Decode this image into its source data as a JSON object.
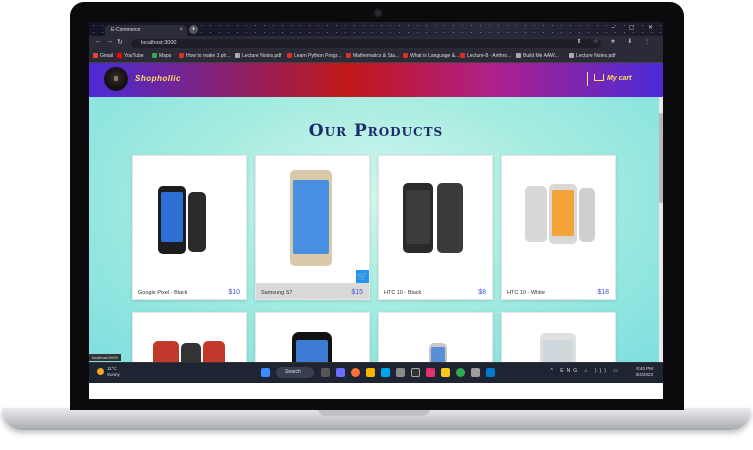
{
  "browser": {
    "tab_title": "E-Commerce",
    "tab_close": "×",
    "new_tab": "+",
    "window_buttons": "– ▢ ✕",
    "back": "←",
    "forward": "→",
    "reload": "↻",
    "url": "localhost:3000",
    "address_icons": "⬆ ☆ ★ ⬇ ⋮",
    "bookmarks": [
      {
        "label": "Gmail",
        "color": "#ea4335"
      },
      {
        "label": "YouTube",
        "color": "#ff0000"
      },
      {
        "label": "Maps",
        "color": "#34a853"
      },
      {
        "label": "How to make 3 ph...",
        "color": "#d93025"
      },
      {
        "label": "Lecture Notes.pdf",
        "color": "#aaaaaa"
      },
      {
        "label": "Learn Python Progr...",
        "color": "#d93025"
      },
      {
        "label": "Mathematics & Sta...",
        "color": "#d93025"
      },
      {
        "label": "What is Language &...",
        "color": "#d93025"
      },
      {
        "label": "Lecture-8 - Anthro...",
        "color": "#d93025"
      },
      {
        "label": "Build Me AAW...",
        "color": "#aaaaaa"
      },
      {
        "label": "Lecture Notes.pdf",
        "color": "#aaaaaa"
      }
    ]
  },
  "navbar": {
    "brand": "Shophollic",
    "cart_label": "My cart"
  },
  "main": {
    "heading": "Our Products",
    "products": [
      {
        "name": "Google Pixel - Black",
        "price": "$10",
        "phone_color": "#1d1d1f",
        "screen_color": "#2e6fd6"
      },
      {
        "name": "Samsung S7",
        "price": "$15",
        "phone_color": "#d9c9a8",
        "screen_color": "#4a90e2"
      },
      {
        "name": "HTC 10 - Black",
        "price": "$8",
        "phone_color": "#2a2a2a",
        "screen_color": "#3b3b3b"
      },
      {
        "name": "HTC 10 - White",
        "price": "$18",
        "phone_color": "#d8d8d8",
        "screen_color": "#f2a33a"
      },
      {
        "name": "",
        "price": "",
        "phone_color": "#c0392b",
        "screen_color": "#333333"
      },
      {
        "name": "",
        "price": "",
        "phone_color": "#111111",
        "screen_color": "#3c7bd6"
      },
      {
        "name": "",
        "price": "",
        "phone_color": "#c7c7c7",
        "screen_color": "#5a8fd6"
      },
      {
        "name": "",
        "price": "",
        "phone_color": "#e0e0e0",
        "screen_color": "#cfd8dc"
      }
    ],
    "add_to_cart_icon": "🛒"
  },
  "taskbar": {
    "weather_line1": "11°C",
    "weather_line2": "Sunny",
    "search_label": "Search",
    "tooltip": "localhost:3000",
    "tray": "^ ENG ⌂ ))) ▭",
    "time": "9:40 PM",
    "date": "3/4/2023"
  }
}
